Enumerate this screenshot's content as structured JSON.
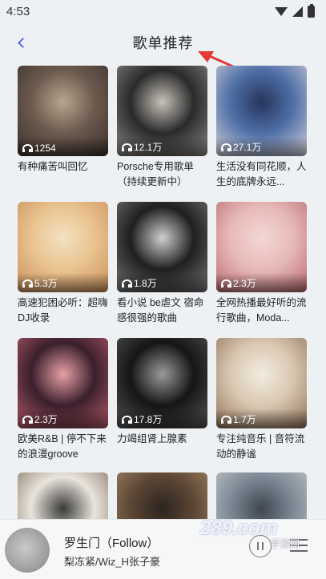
{
  "status": {
    "time": "4:53"
  },
  "header": {
    "title": "歌单推荐"
  },
  "playlists": [
    {
      "count": "1254",
      "title": "有种痛苦叫回忆",
      "colors": [
        "#6b5a4e",
        "#3a2f2a",
        "#b9a48e"
      ]
    },
    {
      "count": "12.1万",
      "title": "Porsche专用歌单（持续更新中）",
      "colors": [
        "#2a2a2c",
        "#8c8a86",
        "#c7c2b8"
      ]
    },
    {
      "count": "27.1万",
      "title": "生活没有同花顺，人生的底牌永远...",
      "colors": [
        "#4f6fa6",
        "#d8d4dc",
        "#27355c"
      ]
    },
    {
      "count": "5.3万",
      "title": "高速犯困必听：超嗨DJ收录",
      "colors": [
        "#e9c38f",
        "#c98c5b",
        "#f3e1c2"
      ]
    },
    {
      "count": "1.8万",
      "title": "看小说 be虐文 宿命感很强的歌曲",
      "colors": [
        "#1f1f1f",
        "#777777",
        "#cfcfcf"
      ]
    },
    {
      "count": "2.3万",
      "title": "全网热播最好听的流行歌曲，Moda...",
      "colors": [
        "#e7b9b9",
        "#b9696d",
        "#f3d8d3"
      ]
    },
    {
      "count": "2.3万",
      "title": "欧美R&B | 停不下来的浪漫groove",
      "colors": [
        "#3a1f2c",
        "#b85b6b",
        "#e8a0a6"
      ]
    },
    {
      "count": "17.8万",
      "title": "力竭组肾上腺素",
      "colors": [
        "#151515",
        "#555555",
        "#9a9a9a"
      ]
    },
    {
      "count": "1.7万",
      "title": "专注纯音乐 | 音符流动的静谧",
      "colors": [
        "#d9c7b1",
        "#8e7056",
        "#f2ece2"
      ]
    },
    {
      "count": "",
      "title": "",
      "colors": [
        "#e9e4dc",
        "#7c6a5a",
        "#3a3a3a"
      ]
    },
    {
      "count": "",
      "title": "",
      "colors": [
        "#5c4634",
        "#a6896a",
        "#2c2520"
      ]
    },
    {
      "count": "",
      "title": "",
      "colors": [
        "#7d8a96",
        "#c7c9cb",
        "#3e4650"
      ]
    }
  ],
  "player": {
    "song": "罗生门（Follow）",
    "artist": "梨冻紧/Wiz_H张子豪"
  },
  "watermark": {
    "text": "289.com",
    "sub": "手游网"
  },
  "colors": {
    "accent": "#4a6fe0",
    "annotation": "#e53935"
  }
}
